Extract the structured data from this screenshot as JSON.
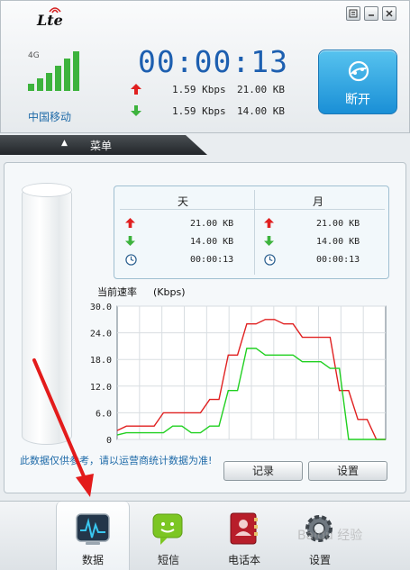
{
  "window": {
    "logo_text": "Lte",
    "controls": [
      "menu",
      "minimize",
      "close"
    ]
  },
  "status": {
    "network_type": "4G",
    "carrier": "中国移动",
    "signal_bars": 5,
    "timer": "00:00:13",
    "upload": {
      "speed": "1.59 Kbps",
      "bytes": "21.00 KB"
    },
    "download": {
      "speed": "1.59 Kbps",
      "bytes": "14.00 KB"
    },
    "connect_label": "断开"
  },
  "menu": {
    "label": "菜单"
  },
  "stats": {
    "day": {
      "title": "天",
      "up": "21.00 KB",
      "down": "14.00 KB",
      "time": "00:00:13"
    },
    "month": {
      "title": "月",
      "up": "21.00 KB",
      "down": "14.00 KB",
      "time": "00:00:13"
    }
  },
  "chart_title": "当前速率",
  "chart_unit": "(Kbps)",
  "chart_data": {
    "type": "line",
    "ylim": [
      0,
      30
    ],
    "yticks": [
      "0",
      "6.0",
      "12.0",
      "18.0",
      "24.0",
      "30.0"
    ],
    "x": [
      0,
      1,
      2,
      3,
      4,
      5,
      6,
      7,
      8,
      9,
      10,
      11,
      12,
      13,
      14,
      15,
      16,
      17,
      18,
      19,
      20,
      21,
      22,
      23,
      24,
      25,
      26,
      27,
      28,
      29
    ],
    "series": [
      {
        "color": "#e02020",
        "values": [
          2,
          3,
          3,
          3,
          3,
          6,
          6,
          6,
          6,
          6,
          9,
          9,
          19,
          19,
          26,
          26,
          27,
          27,
          26,
          26,
          23,
          23,
          23,
          23,
          11,
          11,
          4.5,
          4.5,
          0,
          0
        ]
      },
      {
        "color": "#20d020",
        "values": [
          1,
          1.5,
          1.5,
          1.5,
          1.5,
          1.5,
          3,
          3,
          1.5,
          1.5,
          3,
          3,
          11,
          11,
          20.5,
          20.5,
          19,
          19,
          19,
          19,
          17.5,
          17.5,
          17.5,
          16,
          16,
          0,
          0,
          0,
          0,
          0
        ]
      }
    ],
    "grid": true
  },
  "notice": "此数据仅供参考，请以运营商统计数据为准!",
  "buttons": {
    "record": "记录",
    "settings": "设置"
  },
  "nav": [
    {
      "id": "data",
      "label": "数据"
    },
    {
      "id": "sms",
      "label": "短信"
    },
    {
      "id": "contacts",
      "label": "电话本"
    },
    {
      "id": "settings",
      "label": "设置"
    }
  ],
  "watermark": "Baidu 经验",
  "colors": {
    "accent": "#1d5fb0",
    "button": "#2aa2e2",
    "up": "#e02020",
    "down": "#3db33d"
  }
}
